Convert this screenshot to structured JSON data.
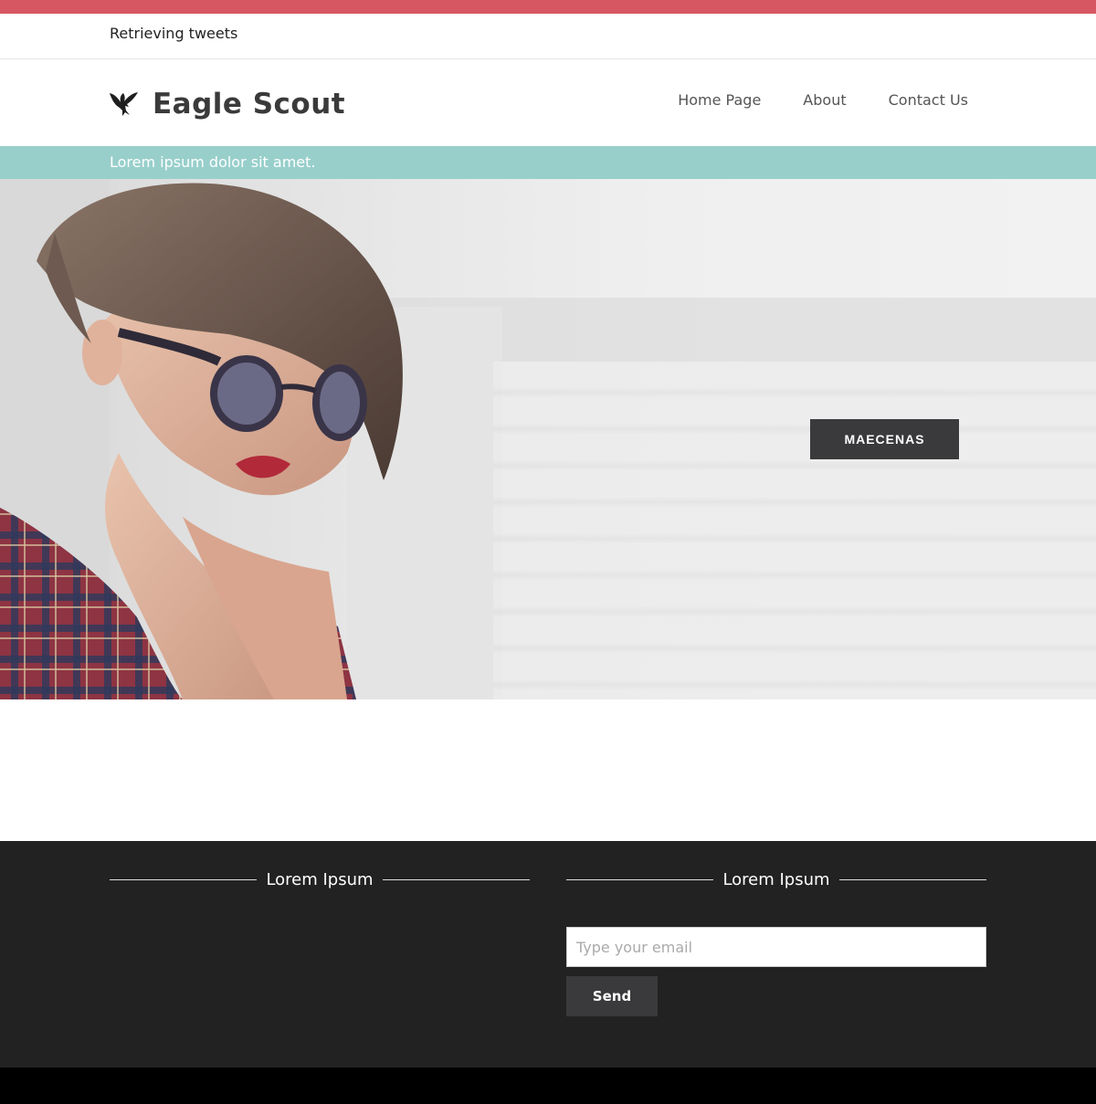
{
  "colors": {
    "top_strip": "#d65761",
    "tagline_bar": "#98cfcb",
    "footer_bg": "#222222",
    "button_bg": "#3a3a3c",
    "bottom_bar": "#000000"
  },
  "tweets": {
    "status": "Retrieving tweets"
  },
  "header": {
    "logo_icon": "eagle-icon",
    "site_title": "Eagle Scout",
    "nav": [
      {
        "label": "Home Page"
      },
      {
        "label": "About"
      },
      {
        "label": "Contact Us"
      }
    ]
  },
  "tagline": {
    "text": "Lorem ipsum dolor sit amet."
  },
  "hero": {
    "image_subject": "woman-with-sunglasses",
    "button_label": "MAECENAS"
  },
  "footer": {
    "left": {
      "heading": "Lorem Ipsum"
    },
    "right": {
      "heading": "Lorem Ipsum",
      "email_placeholder": "Type your email",
      "email_value": "",
      "send_label": "Send"
    }
  }
}
